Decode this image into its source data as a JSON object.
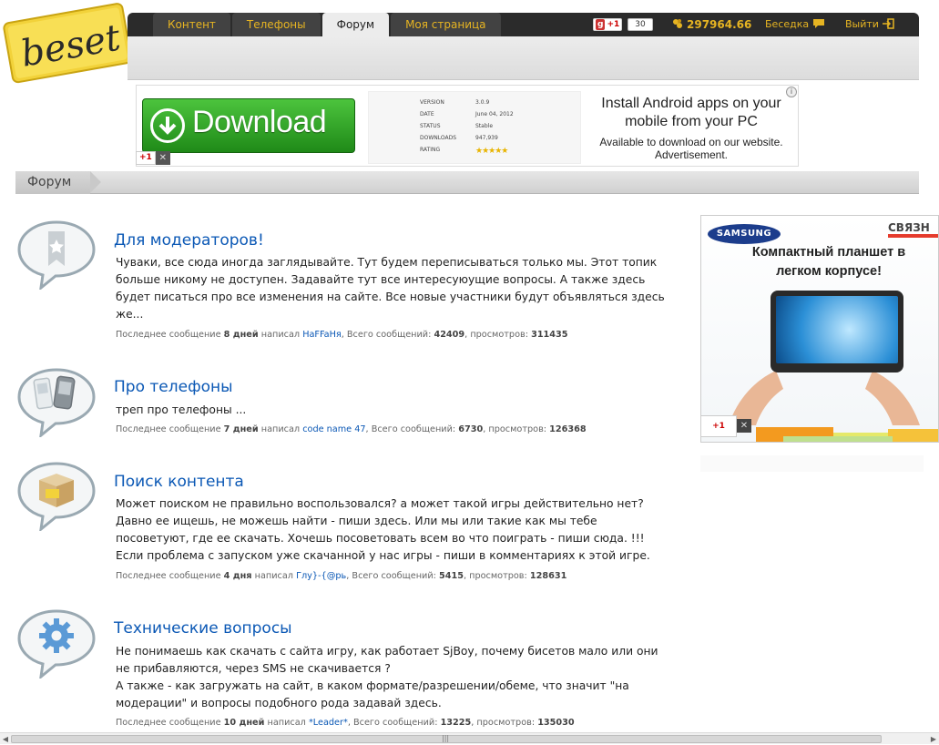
{
  "nav": {
    "tabs": [
      {
        "label": "Контент"
      },
      {
        "label": "Телефоны"
      },
      {
        "label": "Форум"
      },
      {
        "label": "Моя страница"
      }
    ],
    "gplus_label": "+1",
    "gplus_count": "30",
    "coins": "297964.66",
    "chat_label": "Беседка",
    "exit_label": "Выйти"
  },
  "top_ad": {
    "download_label": "Download",
    "specs": [
      {
        "key": "VERSION",
        "value": "3.0.9"
      },
      {
        "key": "DATE",
        "value": "June 04, 2012"
      },
      {
        "key": "STATUS",
        "value": "Stable"
      },
      {
        "key": "DOWNLOADS",
        "value": "947,939"
      },
      {
        "key": "RATING",
        "value": "★★★★★"
      }
    ],
    "headline": "Install Android apps on your mobile from your PC",
    "subline": "Available to download on our website. Advertisement.",
    "gplus_label": "+1",
    "close_label": "✕",
    "info_label": "i"
  },
  "breadcrumb": {
    "label": "Форум"
  },
  "forums": [
    {
      "title": "Для модераторов!",
      "description": "Чуваки, все сюда иногда заглядывайте. Тут будем переписываться только мы. Этот топик больше никому не доступен. Задавайте тут все интересуюущие вопросы. А также здесь будет писаться про все изменения на сайте. Все новые участники будут объявляться здесь же...",
      "meta_prefix": "Последнее сообщение",
      "meta_age": "8 дней",
      "meta_wrote": "написал",
      "author": "HaFFaНя",
      "meta_total_label": ", Всего сообщений:",
      "total": "42409",
      "meta_views_label": ", просмотров:",
      "views": "311435"
    },
    {
      "title": "Про телефоны",
      "description": "треп про телефоны ...",
      "meta_prefix": "Последнее сообщение",
      "meta_age": "7 дней",
      "meta_wrote": "написал",
      "author": "code name 47",
      "meta_total_label": ", Всего сообщений:",
      "total": "6730",
      "meta_views_label": ", просмотров:",
      "views": "126368"
    },
    {
      "title": "Поиск контента",
      "description": "Может поиском не правильно воспользовался? а может такой игры действительно нет? Давно ее ищешь, не можешь найти - пиши здесь. Или мы или такие как мы тебе посоветуют, где ее скачать. Хочешь посоветовать всем во что поиграть - пиши сюда. !!! Если проблема с запуском уже скачанной у нас игры - пиши в комментариях к этой игре.",
      "meta_prefix": "Последнее сообщение",
      "meta_age": "4 дня",
      "meta_wrote": "написал",
      "author": "Глу}-{@рь",
      "meta_total_label": ", Всего сообщений:",
      "total": "5415",
      "meta_views_label": ", просмотров:",
      "views": "128631"
    },
    {
      "title": "Технические вопросы",
      "description": "Не понимаешь как скачать с сайта игру, как работает SjBoy, почему бисетов мало или они не прибавляются, через SMS не скачивается ?\nА также - как загружать на сайт, в каком формате/разрешении/обеме, что значит \"на модерации\" и вопросы подобного рода задавай здесь.",
      "meta_prefix": "Последнее сообщение",
      "meta_age": "10 дней",
      "meta_wrote": "написал",
      "author": "*Leader*",
      "meta_total_label": ", Всего сообщений:",
      "total": "13225",
      "meta_views_label": ", просмотров:",
      "views": "135030"
    }
  ],
  "side_ad": {
    "brand": "SAMSUNG",
    "partner": "СВЯЗН",
    "headline": "Компактный планшет в легком корпусе!",
    "gplus_label": "+1",
    "close_label": "✕"
  },
  "colors": {
    "accent_gold": "#e6b422",
    "link_blue": "#0b58b5",
    "topbar_dark": "#2b2b2b"
  }
}
